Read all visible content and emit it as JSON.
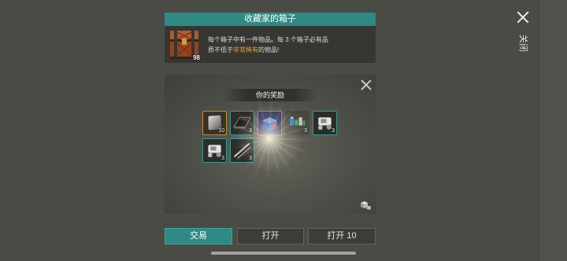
{
  "header": {
    "title": "收藏家的箱子",
    "chest_icon": "collector-chest",
    "chest_count": "98",
    "description": {
      "line1": "每个箱子中有一件物品。每 3 个箱子必有品",
      "line2_prefix": "质不低于",
      "line2_highlight": "非常稀有",
      "line2_suffix": "的物品!"
    }
  },
  "rewards": {
    "title": "你的奖励",
    "items": [
      {
        "icon": "metal-plate",
        "count": "10",
        "rarity_color": "#c98a2e"
      },
      {
        "icon": "black-sheet",
        "count": "3",
        "rarity_color": "#2f9a93"
      },
      {
        "icon": "blue-box",
        "rarity_color": "#9468cc"
      },
      {
        "icon": "battery-parts",
        "count": "3"
      },
      {
        "icon": "engine-part",
        "count": "3",
        "rarity_color": "#2f9a93"
      },
      {
        "icon": "engine-part",
        "count": "3",
        "rarity_color": "#2f9a93"
      },
      {
        "icon": "metal-rods",
        "count": "3",
        "rarity_color": "#2f9a93"
      }
    ],
    "loot_info_icon": "dice-icon"
  },
  "buttons": {
    "trade": "交易",
    "open": "打开",
    "open_ten": "打开 10"
  },
  "close": {
    "icon": "close-icon",
    "label": "关闭"
  },
  "colors": {
    "accent": "#2e8a83",
    "highlight": "#e3a03a",
    "background": "#4b4b46"
  }
}
